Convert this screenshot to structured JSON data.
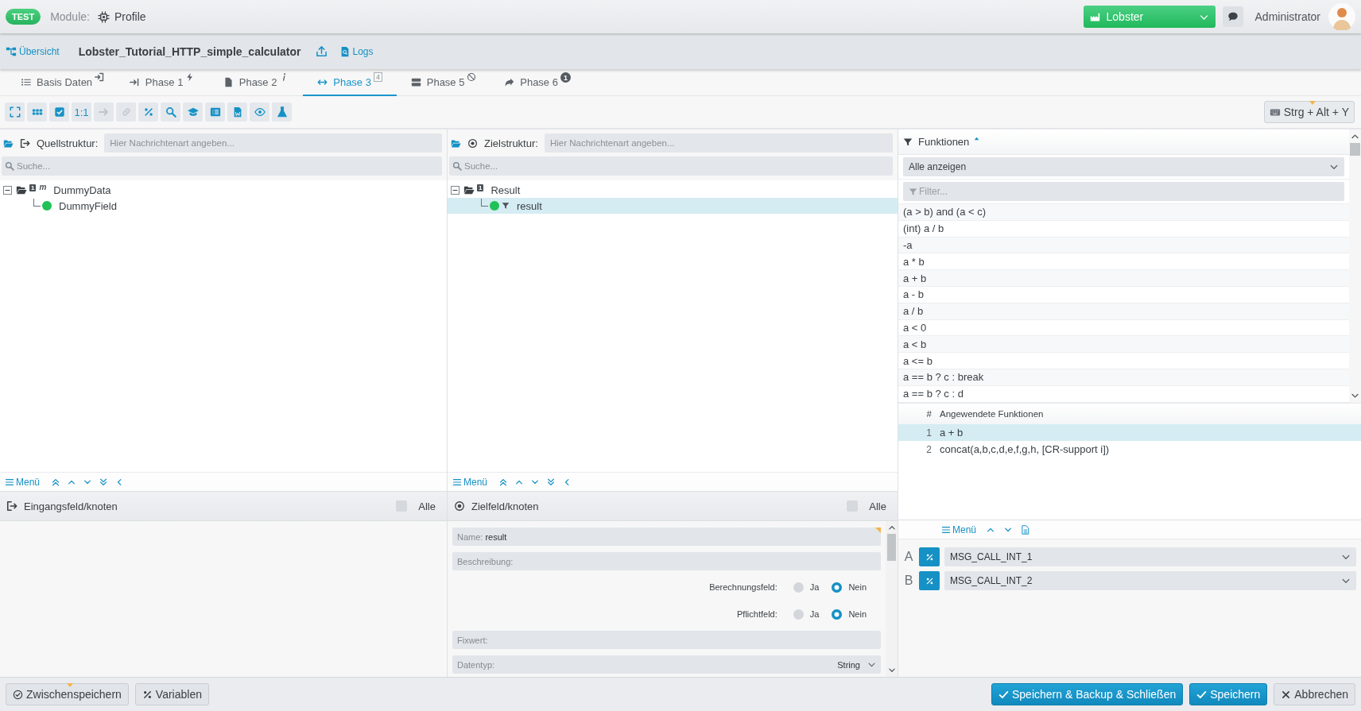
{
  "header": {
    "badge": "TEST",
    "module_label": "Module:",
    "module": "Profile",
    "client": "Lobster",
    "user": "Administrator"
  },
  "project": {
    "overview_link": "Übersicht",
    "title": "Lobster_Tutorial_HTTP_simple_calculator",
    "logs_link": "Logs"
  },
  "tabs": [
    {
      "label": "Basis Daten",
      "selected": false
    },
    {
      "label": "Phase 1",
      "selected": false
    },
    {
      "label": "Phase 2",
      "selected": false
    },
    {
      "label": "Phase 3",
      "selected": true,
      "badge": {
        "text": "4",
        "kind": "box"
      }
    },
    {
      "label": "Phase 5",
      "selected": false
    },
    {
      "label": "Phase 6",
      "selected": false,
      "badge": {
        "text": "1",
        "kind": "circle"
      }
    }
  ],
  "toolbar": {
    "buttons": [
      {
        "disabled": false
      },
      {
        "disabled": false
      },
      {
        "disabled": false
      },
      {
        "label": "1:1",
        "disabled": false
      },
      {
        "disabled": true
      },
      {
        "disabled": true
      },
      {
        "disabled": false
      },
      {
        "disabled": false
      },
      {
        "disabled": false
      },
      {
        "disabled": false
      },
      {
        "disabled": false
      },
      {
        "disabled": false
      },
      {
        "disabled": false
      }
    ],
    "shortcut": "Strg + Alt + Y"
  },
  "source": {
    "label": "Quellstruktur:",
    "placeholder": "Hier Nachrichtenart angeben...",
    "search_placeholder": "Suche...",
    "tree": [
      {
        "name": "DummyData",
        "kind": "node",
        "badge": "1",
        "marker": "m",
        "expanded": true,
        "selected": false,
        "children": [
          {
            "name": "DummyField",
            "kind": "field",
            "filter": false,
            "selected": false
          }
        ]
      }
    ],
    "menu": "Menü",
    "node_header": "Eingangsfeld/knoten",
    "all_label": "Alle",
    "all_checked": false
  },
  "target": {
    "label": "Zielstruktur:",
    "placeholder": "Hier Nachrichtenart angeben...",
    "search_placeholder": "Suche...",
    "tree": [
      {
        "name": "Result",
        "kind": "node",
        "badge": "1",
        "expanded": true,
        "selected": false,
        "children": [
          {
            "name": "result",
            "kind": "field",
            "filter": true,
            "selected": true
          }
        ]
      }
    ],
    "menu": "Menü",
    "node_header": "Zielfeld/knoten",
    "all_label": "Alle",
    "all_checked": false,
    "details": [
      {
        "kind": "text",
        "label": "Name:",
        "value": "result",
        "required": true
      },
      {
        "kind": "text",
        "label": "Beschreibung:"
      },
      {
        "kind": "radio",
        "label": "Berechnungsfeld:",
        "options": [
          {
            "label": "Ja",
            "selected": false
          },
          {
            "label": "Nein",
            "selected": true
          }
        ]
      },
      {
        "kind": "radio",
        "label": "Pflichtfeld:",
        "options": [
          {
            "label": "Ja",
            "selected": false
          },
          {
            "label": "Nein",
            "selected": true
          }
        ]
      },
      {
        "kind": "text",
        "label": "Fixwert:"
      },
      {
        "kind": "select",
        "label": "Datentyp:",
        "value": "String"
      }
    ]
  },
  "functions": {
    "title": "Funktionen",
    "filter_select": "Alle anzeigen",
    "filter_placeholder": "Filter...",
    "items": [
      "(a > b) and (a < c)",
      "(int) a / b",
      "-a",
      "a * b",
      "a + b",
      "a - b",
      "a / b",
      "a < 0",
      "a < b",
      "a <= b",
      "a == b ? c : break",
      "a == b ? c : d"
    ],
    "applied": {
      "columns": [
        "#",
        "Angewendete Funktionen"
      ],
      "rows": [
        {
          "number": "1",
          "name": "a + b",
          "selected": true
        },
        {
          "number": "2",
          "name": "concat(a,b,c,d,e,f,g,h, [CR-support i])",
          "selected": false
        }
      ]
    },
    "menu": "Menü",
    "arguments": [
      {
        "letter": "A",
        "value": "MSG_CALL_INT_1"
      },
      {
        "letter": "B",
        "value": "MSG_CALL_INT_2"
      }
    ]
  },
  "footer": {
    "left_buttons": [
      {
        "label": "Zwischenspeichern",
        "kind": "secondary"
      },
      {
        "label": "Variablen",
        "kind": "secondary"
      }
    ],
    "right_buttons": [
      {
        "label": "Speichern & Backup & Schließen",
        "kind": "primary"
      },
      {
        "label": "Speichern",
        "kind": "primary"
      },
      {
        "label": "Abbrechen",
        "kind": "secondary"
      }
    ]
  }
}
